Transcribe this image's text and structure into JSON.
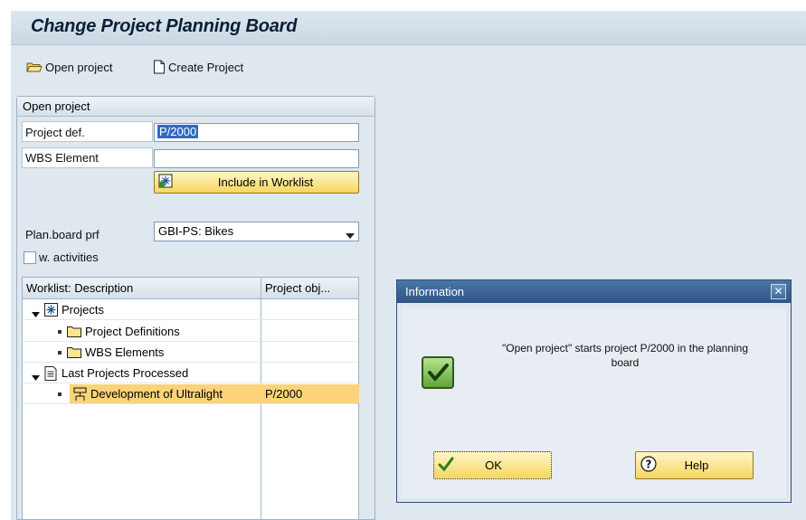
{
  "window": {
    "title": "Change Project Planning Board"
  },
  "toolbar": {
    "open_project": "Open project",
    "create_project": "Create Project"
  },
  "panel": {
    "title": "Open project",
    "project_def_label": "Project def.",
    "project_def_value": "P/2000",
    "wbs_label": "WBS Element",
    "wbs_value": "",
    "include_button": "Include in Worklist",
    "planboard_label": "Plan.board prf",
    "planboard_value": "GBI-PS: Bikes",
    "activities_label": "w. activities",
    "activities_checked": false
  },
  "worklist": {
    "col_description": "Worklist: Description",
    "col_object": "Project obj...",
    "rows": [
      {
        "label": "Projects",
        "object": ""
      },
      {
        "label": "Project Definitions",
        "object": ""
      },
      {
        "label": "WBS Elements",
        "object": ""
      },
      {
        "label": "Last Projects Processed",
        "object": ""
      },
      {
        "label": "Development of Ultralight",
        "object": "P/2000",
        "selected": true
      }
    ]
  },
  "dialog": {
    "title": "Information",
    "message_line1": "\"Open project\" starts project P/2000 in the planning",
    "message_line2": "board",
    "ok_label": "OK",
    "help_label": "Help"
  },
  "colors": {
    "accent": "#2e5584",
    "selection": "#fbd37a",
    "button": "#f6d660"
  }
}
